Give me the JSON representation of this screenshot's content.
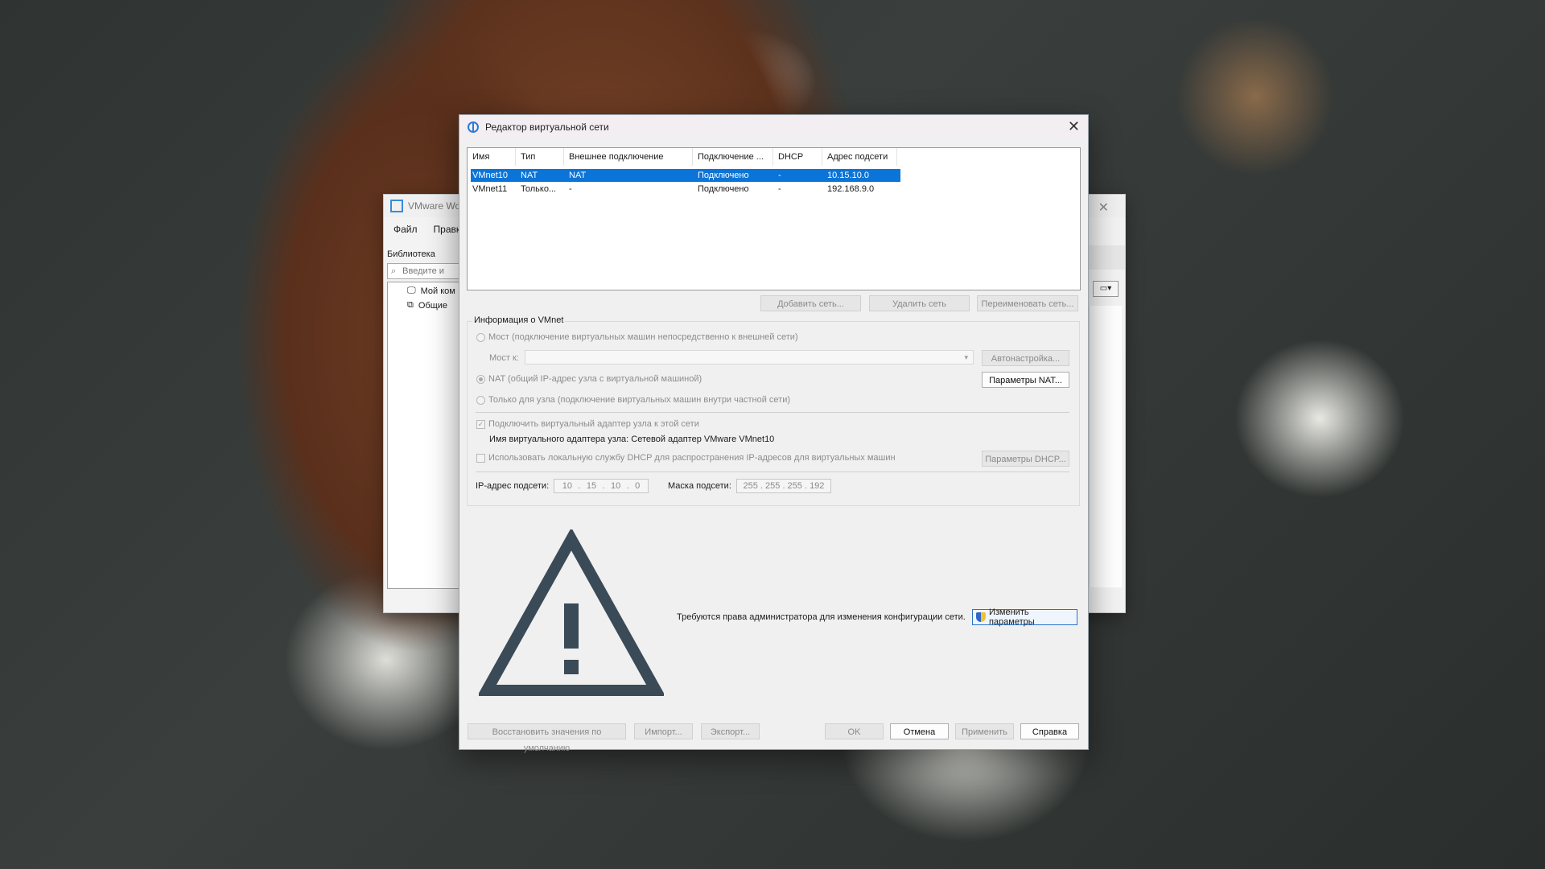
{
  "background_window": {
    "title": "VMware Wo",
    "menu": [
      "Файл",
      "Правка"
    ],
    "library_label": "Библиотека",
    "search_placeholder": "Введите и",
    "tree_items": [
      "Мой ком",
      "Общие"
    ]
  },
  "dialog": {
    "title": "Редактор виртуальной сети",
    "table": {
      "columns": [
        "Имя",
        "Тип",
        "Внешнее подключение",
        "Подключение ...",
        "DHCP",
        "Адрес подсети"
      ],
      "rows": [
        [
          "VMnet10",
          "NAT",
          "NAT",
          "Подключено",
          "-",
          "10.15.10.0"
        ],
        [
          "VMnet11",
          "Только...",
          "-",
          "Подключено",
          "-",
          "192.168.9.0"
        ]
      ],
      "selected_row": 0
    },
    "net_buttons": {
      "add": "Добавить сеть...",
      "remove": "Удалить сеть",
      "rename": "Переименовать сеть..."
    },
    "vmnet_info": {
      "group_label": "Информация о VMnet",
      "bridge_radio": "Мост (подключение виртуальных машин непосредственно к внешней сети)",
      "bridge_to_label": "Мост к:",
      "auto_button": "Автонастройка...",
      "nat_radio": "NAT (общий IP-адрес узла с виртуальной машиной)",
      "nat_settings_button": "Параметры NAT...",
      "host_only_radio": "Только для узла (подключение виртуальных машин внутри частной сети)",
      "connect_adapter_check": "Подключить виртуальный адаптер узла к этой сети",
      "adapter_name": "Имя виртуального адаптера узла: Сетевой адаптер VMware VMnet10",
      "dhcp_check": "Использовать локальную службу DHCP для распространения IP-адресов для виртуальных машин",
      "dhcp_settings_button": "Параметры DHCP...",
      "subnet_ip_label": "IP-адрес подсети:",
      "subnet_ip": [
        "10",
        "15",
        "10",
        "0"
      ],
      "subnet_mask_label": "Маска подсети:",
      "subnet_mask": [
        "255",
        "255",
        "255",
        "192"
      ]
    },
    "admin_message": "Требуются права администратора для изменения конфигурации сети.",
    "admin_button": "Изменить параметры",
    "footer": {
      "restore": "Восстановить значения по умолчанию",
      "import": "Импорт...",
      "export": "Экспорт...",
      "ok": "OK",
      "cancel": "Отмена",
      "apply": "Применить",
      "help": "Справка"
    }
  }
}
